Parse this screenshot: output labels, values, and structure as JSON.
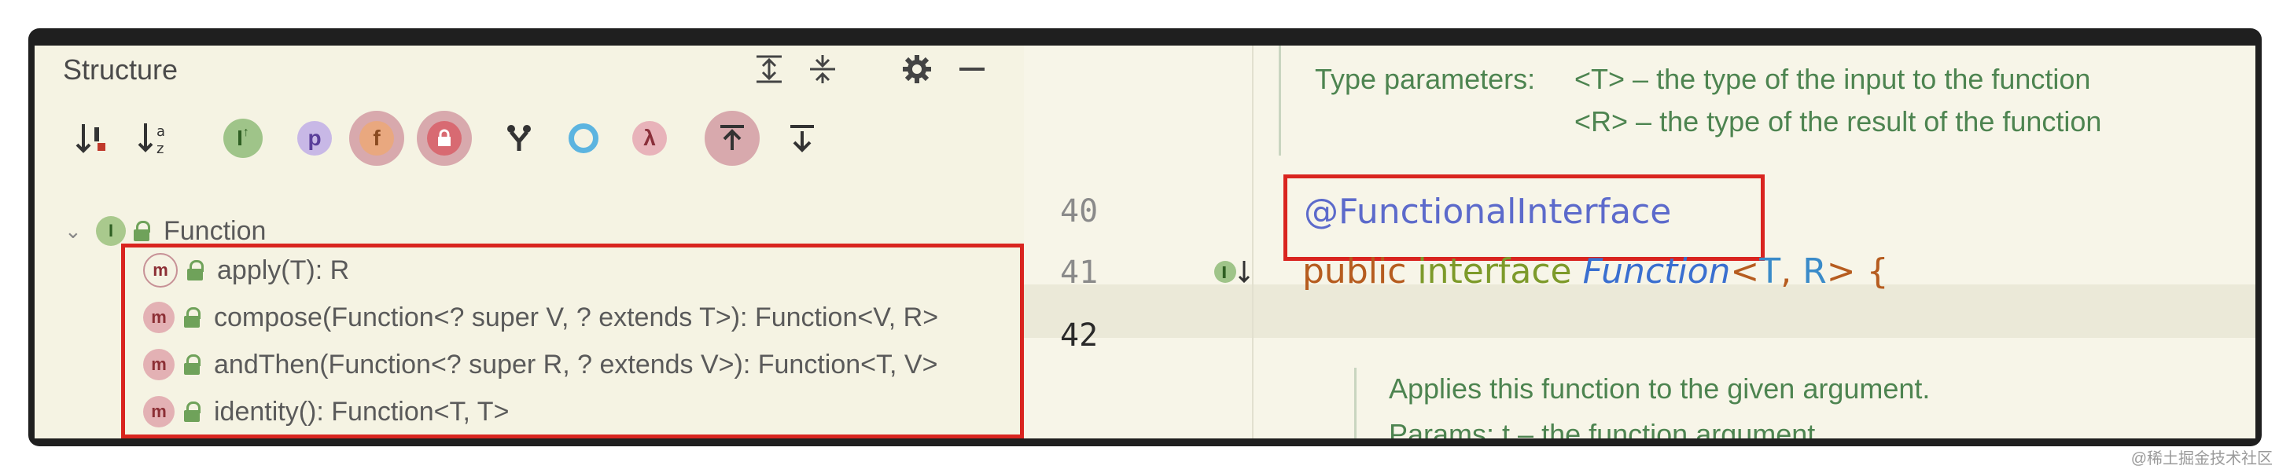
{
  "structure": {
    "title": "Structure",
    "header_icons": [
      "expand-all-icon",
      "collapse-all-icon",
      "gear-icon",
      "minimize-icon"
    ],
    "toolbar": [
      {
        "name": "sort-visibility-icon",
        "glyph": "↓",
        "accent": "!"
      },
      {
        "name": "sort-alpha-icon",
        "glyph": "↓ᵃz"
      },
      {
        "name": "show-inherited-icon",
        "glyph": "I"
      },
      {
        "name": "show-properties-icon",
        "glyph": "p"
      },
      {
        "name": "show-fields-icon",
        "glyph": "f"
      },
      {
        "name": "show-non-public-icon",
        "glyph": "🔒"
      },
      {
        "name": "show-anonymous-icon",
        "glyph": "Y"
      },
      {
        "name": "show-members-icon",
        "glyph": "○"
      },
      {
        "name": "show-lambdas-icon",
        "glyph": "λ"
      },
      {
        "name": "autoscroll-to-source-icon",
        "glyph": "⇱"
      },
      {
        "name": "autoscroll-from-source-icon",
        "glyph": "⇲"
      }
    ],
    "root": {
      "label": "Function",
      "icon": "I"
    },
    "methods": [
      {
        "label": "apply(T): R"
      },
      {
        "label": "compose(Function<? super V, ? extends T>): Function<V, R>"
      },
      {
        "label": "andThen(Function<? super R, ? extends V>): Function<T, V>"
      },
      {
        "label": "identity(): Function<T, T>"
      }
    ],
    "method_icon": "m"
  },
  "editor": {
    "doc_top": {
      "line1_label": "Type parameters:",
      "line1_text": "<T> – the type of the input to the function",
      "line2_text": "<R> – the type of the result of the function"
    },
    "lines": [
      {
        "num": "40",
        "annotation": "@FunctionalInterface"
      },
      {
        "num": "41",
        "kw_public": "public",
        "kw_interface": "interface",
        "name": "Function",
        "lt": "<",
        "t": "T",
        "comma": ",",
        "r": "R",
        "gt": ">",
        "brace": "{"
      },
      {
        "num": "42"
      }
    ],
    "doc_bottom": {
      "line1": "Applies this function to the given argument.",
      "line2": "Params:  t – the function argument"
    }
  },
  "watermark": "@稀土掘金技术社区",
  "colors": {
    "highlight_box": "#d9241f",
    "doc_text": "#4d8450",
    "annotation": "#5c6acb"
  }
}
